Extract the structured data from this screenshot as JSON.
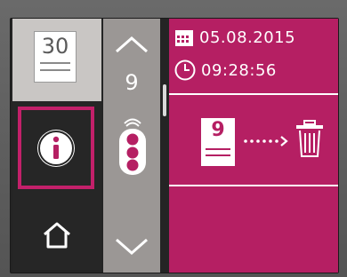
{
  "left_panel": {
    "document_number": "30",
    "info_icon": "info-icon",
    "home_icon": "home-icon"
  },
  "scroll": {
    "up_icon": "chevron-up-icon",
    "value": "9",
    "down_icon": "chevron-down-icon"
  },
  "details": {
    "date": "05.08.2015",
    "time": "09:28:56",
    "document_number": "9",
    "action_icon": "trash-icon"
  },
  "colors": {
    "accent": "#b51f63",
    "panel_gray": "#c9c6c4",
    "mid_gray": "#9b9795"
  }
}
